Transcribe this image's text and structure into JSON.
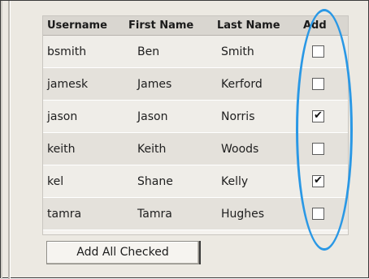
{
  "table": {
    "headers": [
      "Username",
      "First Name",
      "Last Name",
      "Add"
    ],
    "rows": [
      {
        "username": "bsmith",
        "first_name": "Ben",
        "last_name": "Smith",
        "add": false
      },
      {
        "username": "jamesk",
        "first_name": "James",
        "last_name": "Kerford",
        "add": false
      },
      {
        "username": "jason",
        "first_name": "Jason",
        "last_name": "Norris",
        "add": true
      },
      {
        "username": "keith",
        "first_name": "Keith",
        "last_name": "Woods",
        "add": false
      },
      {
        "username": "kel",
        "first_name": "Shane",
        "last_name": "Kelly",
        "add": true
      },
      {
        "username": "tamra",
        "first_name": "Tamra",
        "last_name": "Hughes",
        "add": false
      }
    ]
  },
  "actions": {
    "add_all_checked_label": "Add All Checked"
  },
  "colors": {
    "highlight_oval": "#2a98e5",
    "panel_bg": "#ece9e2",
    "header_bg": "#d9d6d0"
  }
}
